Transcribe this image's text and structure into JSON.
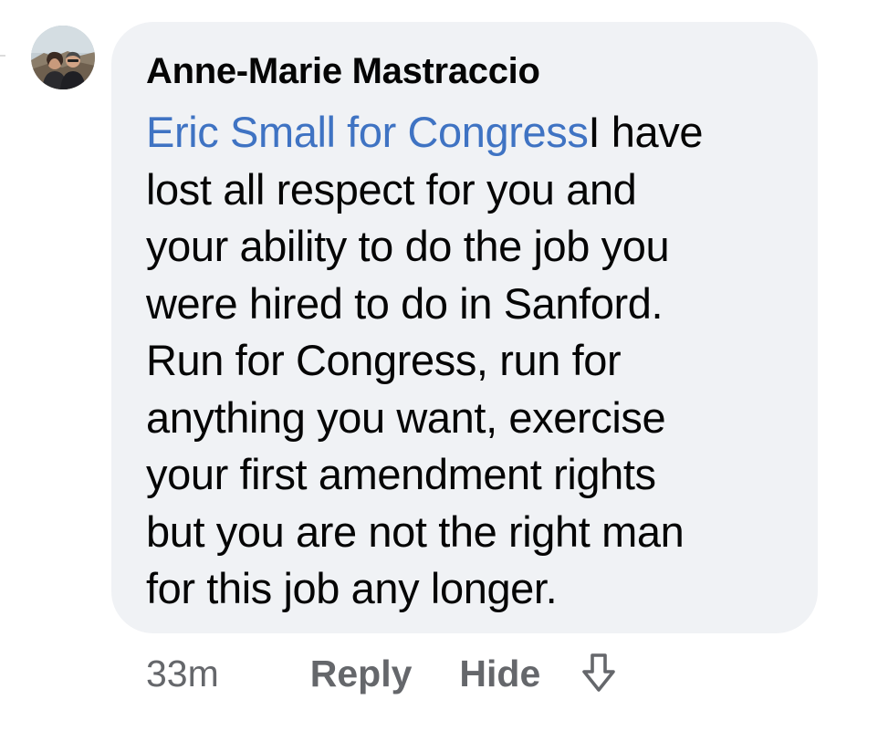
{
  "comment": {
    "author": "Anne-Marie Mastraccio",
    "mention": "Eric Small for Congress",
    "lines": [
      "I have",
      "lost all respect for you and",
      "your ability to do the job you",
      "were hired to do in Sanford.",
      "Run for Congress, run for",
      "anything you want, exercise",
      "your first amendment rights",
      "but you are not the right man",
      "for this job any longer."
    ],
    "avatar_icon": "profile-photo"
  },
  "actions": {
    "timestamp": "33m",
    "reply_label": "Reply",
    "hide_label": "Hide",
    "downvote_icon": "arrow-down-outline-icon"
  },
  "colors": {
    "bubble_bg": "#f0f2f5",
    "mention": "#3f73c3",
    "secondary_text": "#65676b",
    "primary_text": "#050505"
  }
}
